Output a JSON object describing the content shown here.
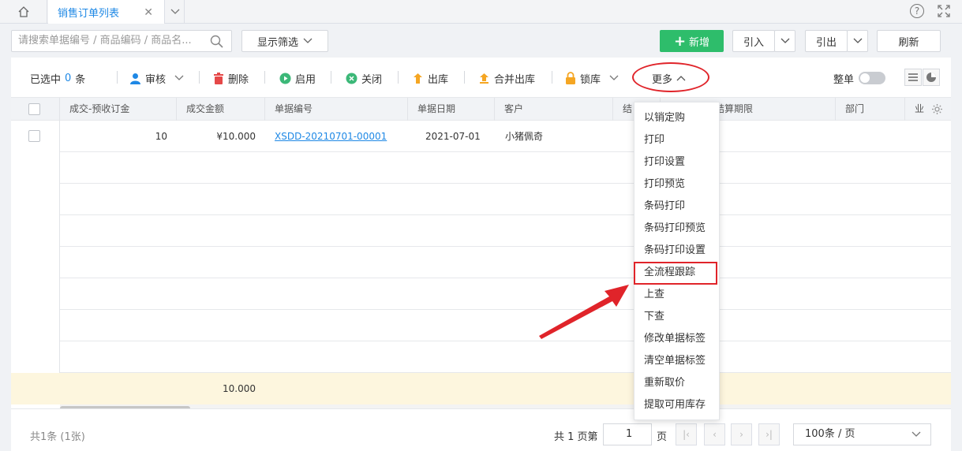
{
  "tabs": {
    "active_label": "销售订单列表"
  },
  "search": {
    "placeholder": "请搜索单据编号 / 商品编码 / 商品名..."
  },
  "filter": {
    "label": "显示筛选"
  },
  "actions": {
    "add": "新增",
    "import": "引入",
    "export": "引出",
    "refresh": "刷新"
  },
  "toolbar": {
    "selected_prefix": "已选中",
    "selected_count": "0",
    "selected_suffix": "条",
    "audit": "审核",
    "delete": "删除",
    "enable": "启用",
    "close": "关闭",
    "outbound": "出库",
    "merge_outbound": "合并出库",
    "lock_stock": "锁库",
    "more": "更多",
    "whole_order": "整单"
  },
  "table": {
    "columns": [
      "成交-预收订金",
      "成交金额",
      "单据编号",
      "单据日期",
      "客户",
      "结",
      "结算期限",
      "部门",
      "业"
    ],
    "rows": [
      {
        "deposit": "10",
        "amount": "¥10.000",
        "order_no": "XSDD-20210701-00001",
        "date": "2021-07-01",
        "customer": "小猪佩奇"
      }
    ],
    "sum_amount": "10.000"
  },
  "footer": {
    "total": "共1条 (1张)",
    "pages_prefix": "共 1 页第",
    "current_page": "1",
    "page_suffix": "页",
    "page_size": "100条 / 页"
  },
  "more_menu": {
    "items": [
      "以销定购",
      "打印",
      "打印设置",
      "打印预览",
      "条码打印",
      "条码打印预览",
      "条码打印设置",
      "全流程跟踪",
      "上查",
      "下查",
      "修改单据标签",
      "清空单据标签",
      "重新取价",
      "提取可用库存"
    ]
  },
  "colors": {
    "accent": "#1e88e5",
    "add_green": "#2ebd6b",
    "annotation_red": "#e0242a"
  }
}
